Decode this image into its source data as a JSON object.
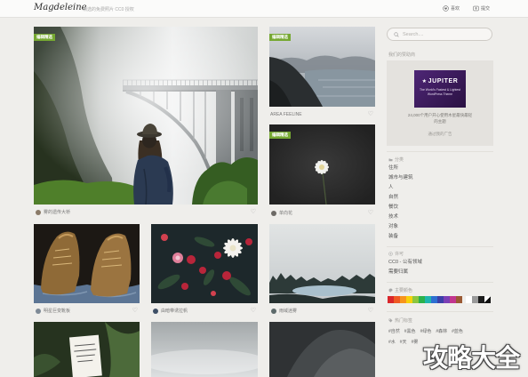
{
  "header": {
    "logo": "Magdeleine",
    "tagline": "精选的免费照片 CC0 授权",
    "likes_label": "喜欢",
    "submit_label": "提交"
  },
  "photos": {
    "hero": {
      "badge": "编辑精选",
      "caption": "雾的遗传大桥"
    },
    "lake": {
      "badge": "编辑精选",
      "caption": "AREA FEELINE"
    },
    "flower": {
      "badge": "编辑精选",
      "caption": "单向花"
    },
    "boots": {
      "caption": "明星巨变靴板"
    },
    "dark_flowers": {
      "caption": "由暗带诱拉帆"
    },
    "misty_lake": {
      "caption": "雨域迷雾"
    }
  },
  "sidebar": {
    "search_placeholder": "Search....",
    "sponsor_label": "我们的赞助商",
    "ad": {
      "brand": "JUPITER",
      "line1": "The World's Fastest & Lightest",
      "line2": "WordPress Theme",
      "text1": "24,000个用户开心使用木星最快最轻",
      "text2": "的主题",
      "cta": "通过我的广告"
    },
    "categories_title": "分类",
    "categories": [
      "住所",
      "城市与建筑",
      "人",
      "自然",
      "餐饮",
      "技术",
      "对象",
      "装备"
    ],
    "license_title": "许可",
    "licenses": [
      "CC0 - 公有领域",
      "需要归属"
    ],
    "colors_title": "主要颜色",
    "colors": [
      "#d9262b",
      "#ef5a24",
      "#f7941d",
      "#f6d10b",
      "#8cc63f",
      "#2bb24c",
      "#1fb5ad",
      "#2e6fd1",
      "#3b3fa8",
      "#7b3fb5",
      "#c2368f",
      "#9b5a34",
      "#ffffff",
      "#9a9a9a",
      "#1c1c1c"
    ],
    "tags_title": "热门标签",
    "tags_row1": [
      "#自然",
      "#黑色",
      "#绿色",
      "#森林",
      "#蓝色"
    ],
    "tags_row2": [
      "#水",
      "#天",
      "#雾"
    ]
  },
  "watermark": "攻略大全",
  "theme": {
    "badge_color": "#76a832",
    "ad_color": "#3d1f5c"
  }
}
